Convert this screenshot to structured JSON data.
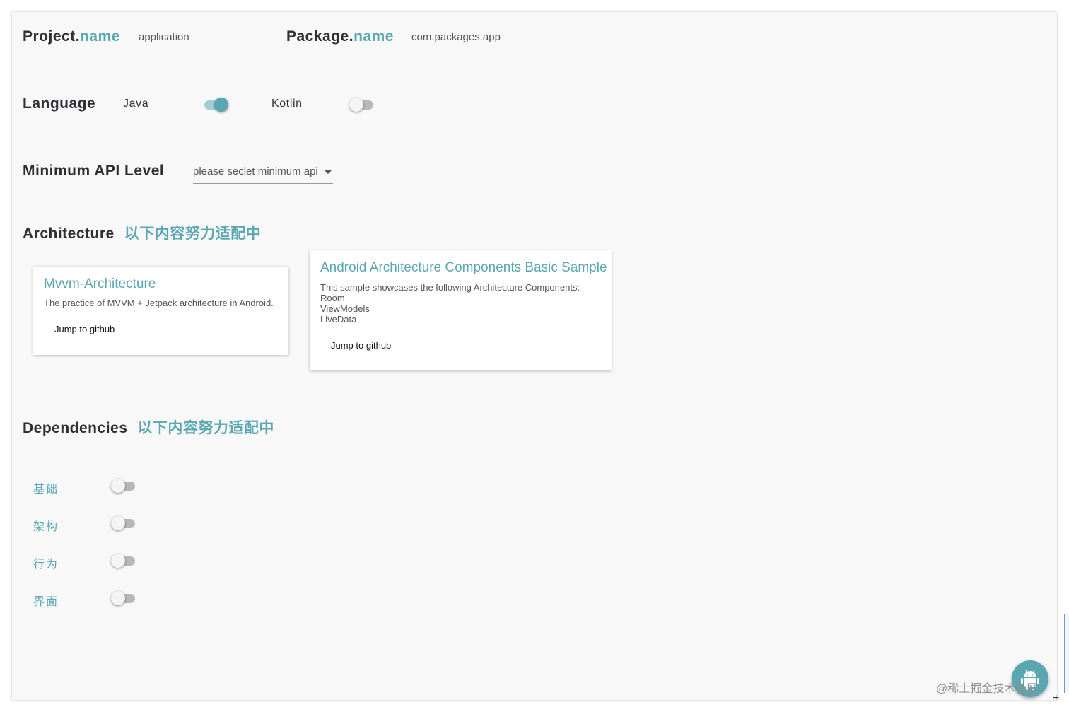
{
  "project": {
    "label_prefix": "Project.",
    "label_accent": "name",
    "value": "application"
  },
  "package": {
    "label_prefix": "Package.",
    "label_accent": "name",
    "value": "com.packages.app"
  },
  "language": {
    "label": "Language",
    "options": [
      {
        "label": "Java",
        "on": true
      },
      {
        "label": "Kotlin",
        "on": false
      }
    ]
  },
  "min_api": {
    "label": "Minimum API Level",
    "placeholder": "please seclet minimum api"
  },
  "architecture": {
    "label": "Architecture",
    "note": "以下内容努力适配中",
    "cards": [
      {
        "title": "Mvvm-Architecture",
        "description": "The practice of MVVM + Jetpack architecture in Android.",
        "button": "Jump to github"
      },
      {
        "title": "Android Architecture Components Basic Sample",
        "description_lines": [
          "This sample showcases the following Architecture Components:",
          "Room",
          "ViewModels",
          "LiveData"
        ],
        "button": "Jump to github"
      }
    ]
  },
  "dependencies": {
    "label": "Dependencies",
    "note": "以下内容努力适配中",
    "items": [
      {
        "label": "基础",
        "on": false
      },
      {
        "label": "架构",
        "on": false
      },
      {
        "label": "行为",
        "on": false
      },
      {
        "label": "界面",
        "on": false
      }
    ]
  },
  "fab": {
    "icon": "android-icon"
  },
  "watermark": "@稀土掘金技术社区",
  "colors": {
    "accent": "#5aa7b1",
    "background": "#f8f8f8"
  }
}
